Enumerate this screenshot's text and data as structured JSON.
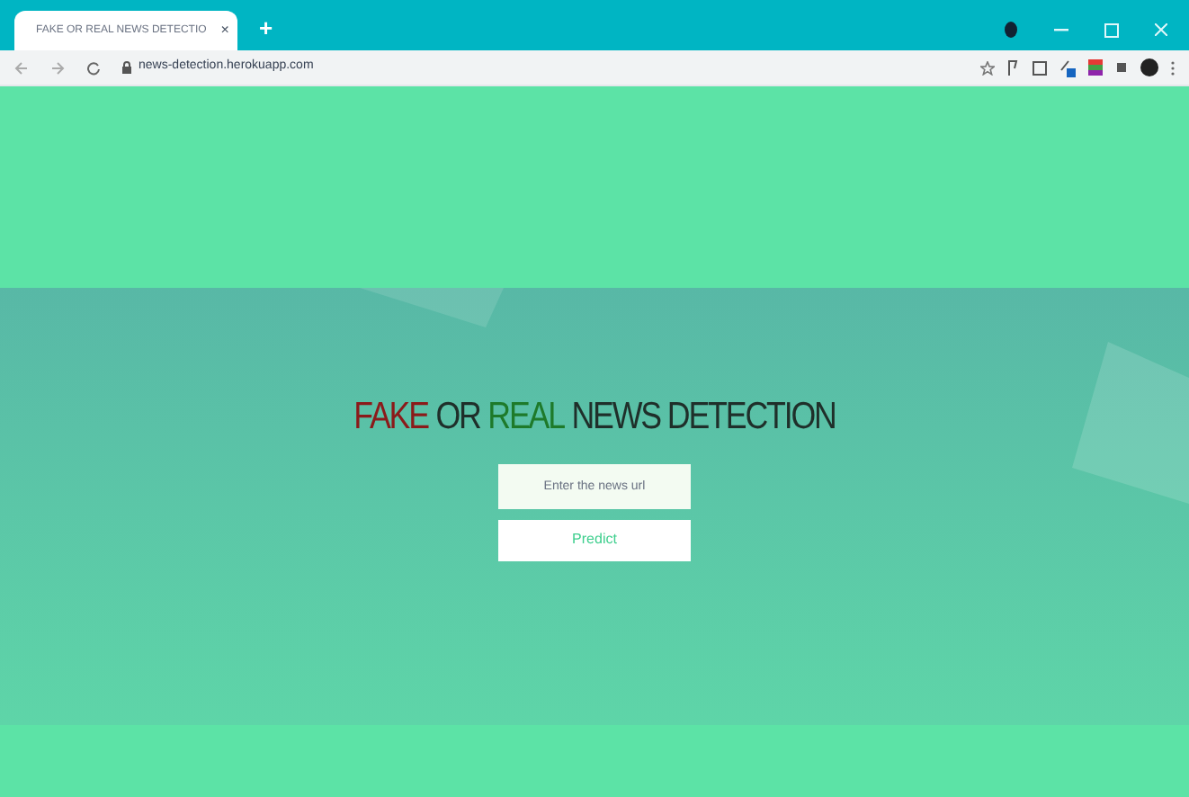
{
  "browser": {
    "tab_title": "FAKE OR REAL NEWS DETECTIO",
    "tab_close": "×",
    "new_tab": "+",
    "url": "news-detection.herokuapp.com"
  },
  "heading": [
    {
      "text": "FAKE",
      "color": "#8b1a1a"
    },
    {
      "text": "OR",
      "color": "#1f2f2a"
    },
    {
      "text": "REAL",
      "color": "#1e7a2a"
    },
    {
      "text": "NEWS DETECTION",
      "color": "#1f2f2a"
    }
  ],
  "form": {
    "placeholder": "Enter the news url",
    "button": "Predict"
  }
}
